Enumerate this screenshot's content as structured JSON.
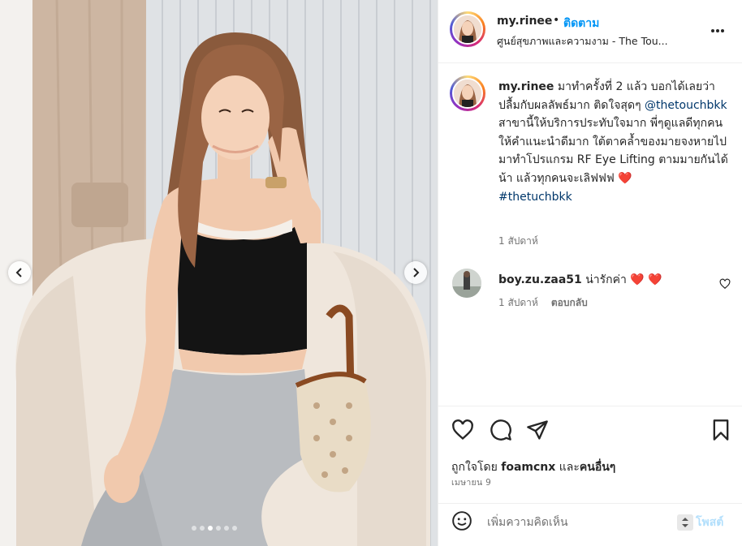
{
  "header": {
    "username": "my.rinee",
    "bullet": "•",
    "follow_label": "ติดตาม",
    "location": "ศูนย์สุขภาพและความงาม - The Tou..."
  },
  "caption": {
    "username": "my.rinee",
    "text_1": "มาทำครั้งที่ 2 แล้ว บอกได้เลยว่าปลื้มกับผลลัพธ์มาก ติดใจสุดๆ",
    "mention": "@thetouchbkk",
    "text_2": "สาขานี้ให้บริการประทับใจมาก พี่ๆดูแลดีทุกคน ให้คำแนะนำดีมาก ใต้ตาคล้ำของมายจงหายไป มาทำโปรแกรม RF Eye Lifting ตามมายกันได้น้า แล้วทุกคนจะเลิฟฟฟ",
    "heart": "❤️",
    "hashtag": "#thetuchbkk",
    "time": "1 สัปดาห์"
  },
  "comment": {
    "username": "boy.zu.zaa51",
    "text": "น่ารักค่า",
    "hearts": "❤️ ❤️",
    "time": "1 สัปดาห์",
    "reply_label": "ตอบกลับ"
  },
  "likes": {
    "prefix": "ถูกใจโดย",
    "user": "foamcnx",
    "middle": "และ",
    "others": "คนอื่นๆ"
  },
  "post_date": "เมษายน 9",
  "comment_box": {
    "placeholder": "เพิ่มความคิดเห็น",
    "post_label": "โพสต์"
  },
  "carousel": {
    "count": 6,
    "active_index": 2
  },
  "icons": {
    "more": "more-horizontal-icon",
    "like": "heart-outline-icon",
    "comment": "comment-bubble-icon",
    "share": "paper-plane-icon",
    "save": "bookmark-icon",
    "emoji": "smiley-icon"
  },
  "colors": {
    "follow_blue": "#0095f6",
    "link_blue": "#00376b",
    "heart_red": "#ed4956",
    "post_disabled": "#b2dffc"
  }
}
